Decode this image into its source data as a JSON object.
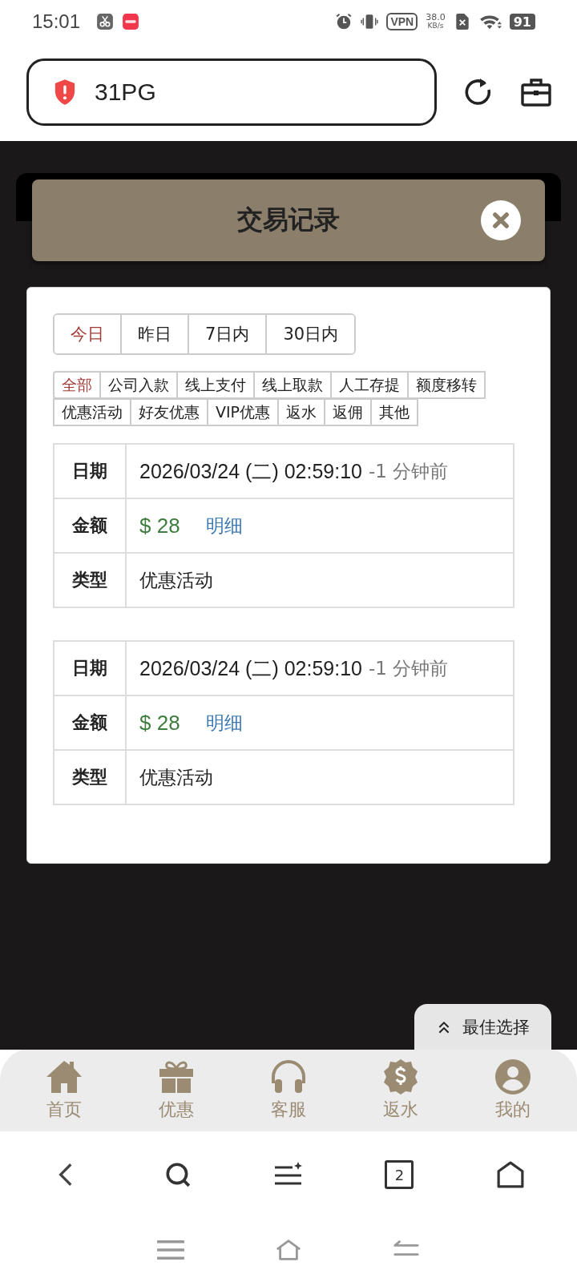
{
  "status_bar": {
    "time": "15:01",
    "vpn": "VPN",
    "speed": "38.0",
    "speed_unit": "KB/s",
    "battery": "91"
  },
  "address_bar": {
    "text": "31PG"
  },
  "modal": {
    "title": "交易记录",
    "date_tabs": [
      {
        "label": "今日",
        "selected": true
      },
      {
        "label": "昨日",
        "selected": false
      },
      {
        "label": "7日内",
        "selected": false
      },
      {
        "label": "30日内",
        "selected": false
      }
    ],
    "filters": [
      {
        "label": "全部",
        "selected": true
      },
      {
        "label": "公司入款",
        "selected": false
      },
      {
        "label": "线上支付",
        "selected": false
      },
      {
        "label": "线上取款",
        "selected": false
      },
      {
        "label": "人工存提",
        "selected": false
      },
      {
        "label": "额度移转",
        "selected": false
      },
      {
        "label": "优惠活动",
        "selected": false
      },
      {
        "label": "好友优惠",
        "selected": false
      },
      {
        "label": "VIP优惠",
        "selected": false
      },
      {
        "label": "返水",
        "selected": false
      },
      {
        "label": "返佣",
        "selected": false
      },
      {
        "label": "其他",
        "selected": false
      }
    ],
    "records": [
      {
        "date_label": "日期",
        "date": "2026/03/24 (二) 02:59:10",
        "relative": "-1 分钟前",
        "amount_label": "金额",
        "amount": "$ 28",
        "detail": "明细",
        "type_label": "类型",
        "type": "优惠活动"
      },
      {
        "date_label": "日期",
        "date": "2026/03/24 (二) 02:59:10",
        "relative": "-1 分钟前",
        "amount_label": "金额",
        "amount": "$ 28",
        "detail": "明细",
        "type_label": "类型",
        "type": "优惠活动"
      }
    ]
  },
  "floating_button": {
    "label": "最佳选择"
  },
  "bottom_nav": {
    "items": [
      {
        "label": "首页"
      },
      {
        "label": "优惠"
      },
      {
        "label": "客服"
      },
      {
        "label": "返水"
      },
      {
        "label": "我的"
      }
    ]
  },
  "browser_toolbar": {
    "tab_count": "2"
  }
}
